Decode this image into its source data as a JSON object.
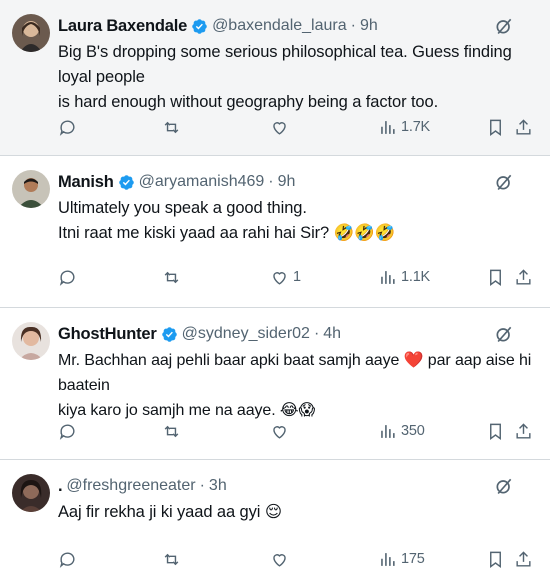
{
  "tweets": [
    {
      "name": "Laura Baxendale",
      "handle": "@baxendale_laura",
      "time": "9h",
      "text_line1": "Big B's dropping some serious philosophical tea. Guess finding loyal people",
      "text_line2": "is hard enough without geography being a factor too.",
      "likes": "",
      "views": "1.7K"
    },
    {
      "name": "Manish",
      "handle": "@aryamanish469",
      "time": "9h",
      "text_line1": "Ultimately you speak a good thing.",
      "text_line2": "Itni raat me kiski yaad aa rahi hai Sir? 🤣🤣🤣",
      "likes": "1",
      "views": "1.1K"
    },
    {
      "name": "GhostHunter",
      "handle": "@sydney_sider02",
      "time": "4h",
      "text_line1": "Mr. Bachhan aaj pehli baar apki baat samjh aaye ❤️ par aap aise hi baatein",
      "text_line2": "kiya karo jo samjh me na aaye. 😂😱",
      "likes": "",
      "views": "350"
    },
    {
      "name": ".",
      "handle": "@freshgreeneater",
      "time": "3h",
      "text_line1": "Aaj fir rekha ji ki yaad aa gyi 😌",
      "likes": "",
      "views": "175"
    }
  ],
  "separator": "·",
  "more_label": "···",
  "colors": {
    "verified": "#1d9bf0",
    "icon": "#536471",
    "text": "#0f1419",
    "highlight_bg": "#f4f5f6"
  }
}
